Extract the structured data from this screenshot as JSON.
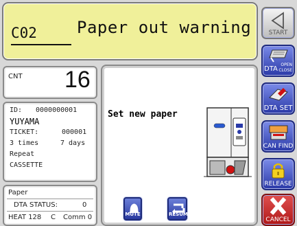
{
  "header": {
    "code": "C02",
    "title": "Paper out warning"
  },
  "counter": {
    "label": "CNT",
    "value": "16"
  },
  "info": {
    "id_label": "ID:",
    "id_value": "0000000001",
    "name": "YUYAMA",
    "ticket_label": "TICKET:",
    "ticket_value": "000001",
    "times": "3 times",
    "days": "7 days",
    "repeat": "Repeat",
    "cassette": "CASSETTE"
  },
  "status": {
    "paper": "Paper",
    "dta_status_label": "DTA STATUS:",
    "dta_status_value": "0",
    "heat": "HEAT 128",
    "heat_c": "C",
    "comm": "Comm 0"
  },
  "main": {
    "message": "Set new paper",
    "mute_label": "MUTE",
    "resume_label": "RESUME"
  },
  "right_buttons": {
    "start": "START",
    "dta_line1": "DTA",
    "dta_open": "OPEN",
    "dta_close": "CLOSE",
    "dta_set": "DTA SET",
    "can_find": "CAN FIND",
    "release": "RELEASE",
    "cancel": "CANCEL"
  },
  "colors": {
    "header_bg": "#f0f09a",
    "button_blue": "#2b3aa8",
    "cancel_red": "#c01f1f",
    "panel_bg": "#ffffff"
  }
}
